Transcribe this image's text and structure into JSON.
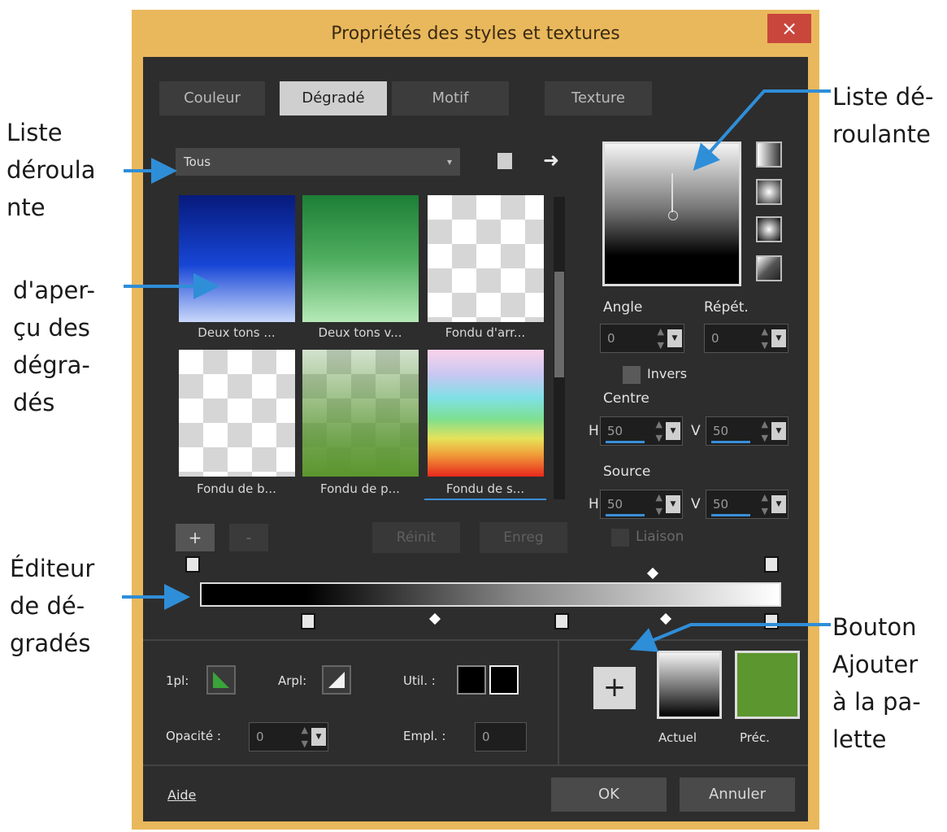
{
  "annotations": {
    "liste_gauche": [
      "Liste",
      "déroula",
      "nte"
    ],
    "liste_droite": [
      "Liste dé-",
      "roulante"
    ],
    "apercu": [
      "d'aper-",
      "çu des",
      "dégra-",
      "dés"
    ],
    "editeur": [
      "Éditeur",
      "de dé-",
      "gradés"
    ],
    "bouton": [
      "Bouton",
      "Ajouter",
      "à la pa-",
      "lette"
    ]
  },
  "window": {
    "title": "Propriétés des styles et textures",
    "close": "×"
  },
  "tabs": [
    {
      "label": "Couleur",
      "active": false
    },
    {
      "label": "Dégradé",
      "active": true
    },
    {
      "label": "Motif",
      "active": false
    },
    {
      "label": "Texture",
      "active": false
    }
  ],
  "filter": {
    "value": "Tous"
  },
  "thumbnails": [
    {
      "label": "Deux tons ..."
    },
    {
      "label": "Deux tons v..."
    },
    {
      "label": "Fondu d'arr..."
    },
    {
      "label": "Fondu de b..."
    },
    {
      "label": "Fondu de p..."
    },
    {
      "label": "Fondu de s..."
    }
  ],
  "angle": {
    "label": "Angle",
    "value": "0"
  },
  "repet": {
    "label": "Répét.",
    "value": "0"
  },
  "invers": {
    "label": "Invers"
  },
  "centre": {
    "label": "Centre",
    "h_label": "H",
    "h": "50",
    "v_label": "V",
    "v": "50"
  },
  "source": {
    "label": "Source",
    "h_label": "H",
    "h": "50",
    "v_label": "V",
    "v": "50"
  },
  "liaison": {
    "label": "Liaison"
  },
  "actions": {
    "add": "+",
    "remove": "-",
    "reinit": "Réinit",
    "save": "Enreg"
  },
  "bottom": {
    "ppl_label": "1pl:",
    "arpl_label": "Arpl:",
    "util_label": "Util. :",
    "opacite_label": "Opacité :",
    "opacite_value": "0",
    "empl_label": "Empl. :",
    "empl_value": "0"
  },
  "palette": {
    "add": "+",
    "actuel": "Actuel",
    "prec": "Préc."
  },
  "footer": {
    "aide": "Aide",
    "ok": "OK",
    "annuler": "Annuler"
  },
  "colors": {
    "accent": "#2f8ed8",
    "frame": "#e9b85c",
    "close": "#c9463d",
    "prec_swatch": "#5b962e"
  }
}
